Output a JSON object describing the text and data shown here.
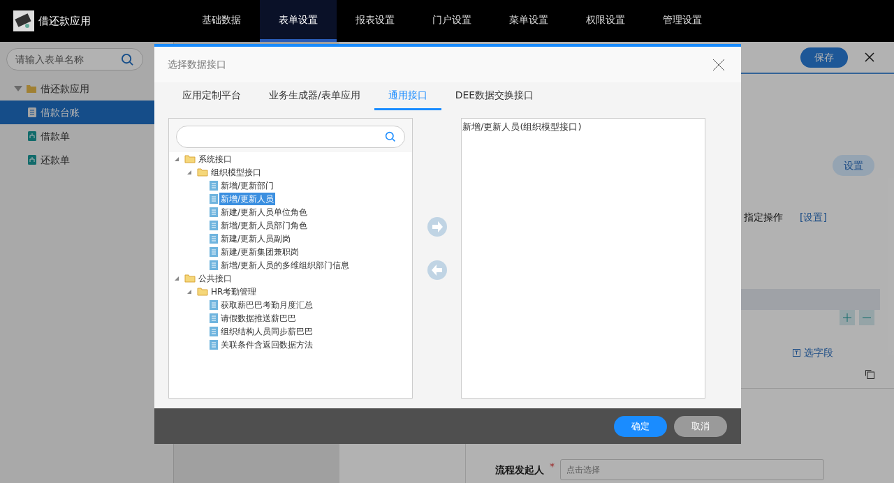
{
  "app": {
    "title": "借还款应用",
    "nav": [
      {
        "label": "基础数据",
        "selected": false
      },
      {
        "label": "表单设置",
        "selected": true
      },
      {
        "label": "报表设置",
        "selected": false
      },
      {
        "label": "门户设置",
        "selected": false
      },
      {
        "label": "菜单设置",
        "selected": false
      },
      {
        "label": "权限设置",
        "selected": false
      },
      {
        "label": "管理设置",
        "selected": false
      }
    ]
  },
  "sidebar": {
    "search_placeholder": "请输入表单名称",
    "tree": [
      {
        "label": "借还款应用",
        "kind": "folder",
        "expanded": true,
        "selected": false,
        "children": [
          {
            "label": "借款台账",
            "kind": "document",
            "selected": true
          },
          {
            "label": "借款单",
            "kind": "form",
            "selected": false
          },
          {
            "label": "还款单",
            "kind": "form",
            "selected": false
          }
        ]
      }
    ]
  },
  "editor": {
    "save_button": "保存",
    "set_button": "设置",
    "option_label": "指定操作",
    "set_link": "[设置]",
    "pick_field_link": "选字段",
    "initiator_label": "流程发起人",
    "required_mark": "*",
    "initiator_placeholder": "点击选择"
  },
  "dialog": {
    "title": "选择数据接口",
    "tabs": [
      {
        "label": "应用定制平台",
        "selected": false
      },
      {
        "label": "业务生成器/表单应用",
        "selected": false
      },
      {
        "label": "通用接口",
        "selected": true
      },
      {
        "label": "DEE数据交换接口",
        "selected": false
      }
    ],
    "tree": [
      {
        "label": "系统接口",
        "kind": "folder",
        "expanded": true,
        "selected": false,
        "children": [
          {
            "label": "组织模型接口",
            "kind": "folder",
            "expanded": true,
            "selected": false,
            "children": [
              {
                "label": "新增/更新部门",
                "kind": "leaf",
                "selected": false
              },
              {
                "label": "新增/更新人员",
                "kind": "leaf",
                "selected": true
              },
              {
                "label": "新建/更新人员单位角色",
                "kind": "leaf",
                "selected": false
              },
              {
                "label": "新增/更新人员部门角色",
                "kind": "leaf",
                "selected": false
              },
              {
                "label": "新建/更新人员副岗",
                "kind": "leaf",
                "selected": false
              },
              {
                "label": "新建/更新集团兼职岗",
                "kind": "leaf",
                "selected": false
              },
              {
                "label": "新增/更新人员的多维组织部门信息",
                "kind": "leaf",
                "selected": false
              }
            ]
          }
        ]
      },
      {
        "label": "公共接口",
        "kind": "folder",
        "expanded": true,
        "selected": false,
        "children": [
          {
            "label": "HR考勤管理",
            "kind": "folder",
            "expanded": true,
            "selected": false,
            "children": [
              {
                "label": "获取薪巴巴考勤月度汇总",
                "kind": "leaf",
                "selected": false
              },
              {
                "label": "请假数据推送薪巴巴",
                "kind": "leaf",
                "selected": false
              },
              {
                "label": "组织结构人员同步薪巴巴",
                "kind": "leaf",
                "selected": false
              },
              {
                "label": "关联条件含返回数据方法",
                "kind": "leaf",
                "selected": false
              }
            ]
          }
        ]
      }
    ],
    "chosen": [
      "新增/更新人员(组织模型接口)"
    ],
    "buttons": [
      {
        "label": "确定",
        "kind": "primary"
      },
      {
        "label": "取消",
        "kind": "secondary"
      }
    ]
  }
}
